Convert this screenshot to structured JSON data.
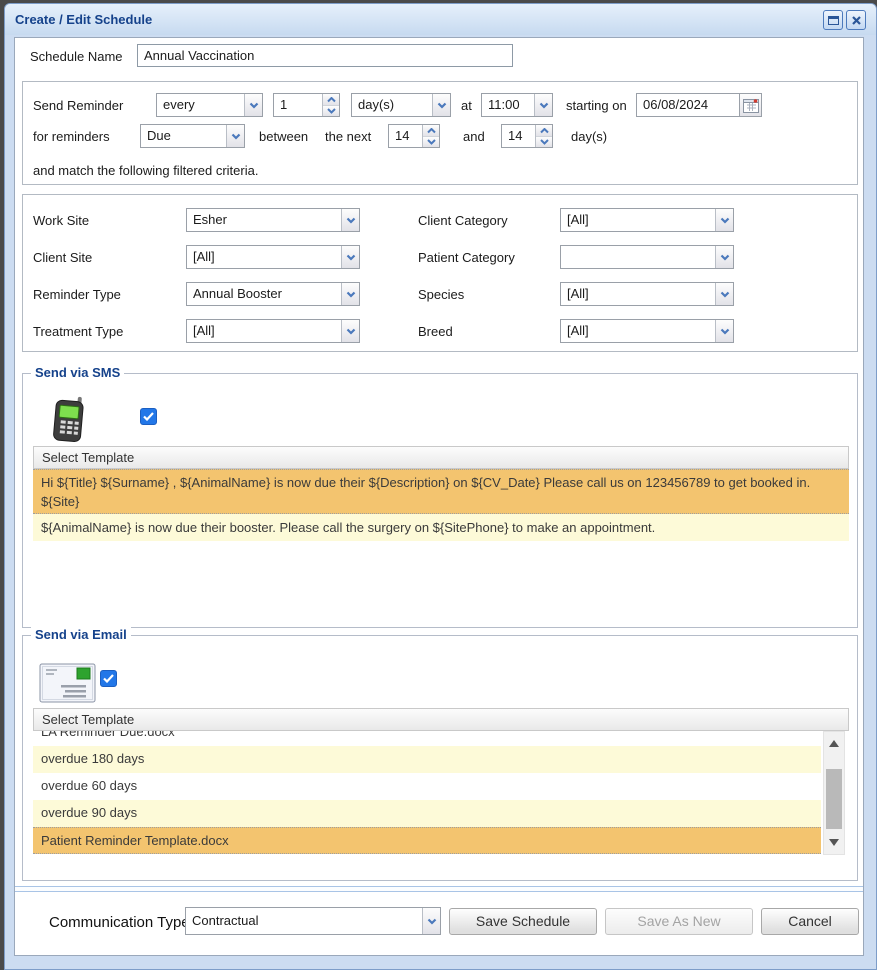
{
  "window": {
    "title": "Create / Edit Schedule"
  },
  "schedule": {
    "name_label": "Schedule Name",
    "name_value": "Annual Vaccination"
  },
  "reminder": {
    "send_label": "Send Reminder",
    "frequency": "every",
    "interval": "1",
    "unit": "day(s)",
    "at_label": "at",
    "time": "11:00",
    "starting_label": "starting on",
    "start_date": "06/08/2024",
    "for_label": "for reminders",
    "status": "Due",
    "between_label": "between",
    "next_label": "the next",
    "window_from": "14",
    "and_label": "and",
    "window_to": "14",
    "days_label": "day(s)",
    "criteria_note": "and match the following filtered criteria."
  },
  "filters": {
    "left": [
      {
        "label": "Work Site",
        "value": "Esher"
      },
      {
        "label": "Client Site",
        "value": "[All]"
      },
      {
        "label": "Reminder Type",
        "value": "Annual Booster"
      },
      {
        "label": "Treatment Type",
        "value": "[All]"
      }
    ],
    "right": [
      {
        "label": "Client Category",
        "value": "[All]"
      },
      {
        "label": "Patient Category",
        "value": ""
      },
      {
        "label": "Species",
        "value": "[All]"
      },
      {
        "label": "Breed",
        "value": "[All]"
      }
    ]
  },
  "sms": {
    "legend": "Send via SMS",
    "checked": true,
    "header": "Select Template",
    "templates": [
      {
        "text": "Hi ${Title} ${Surname} , ${AnimalName} is now due their ${Description} on ${CV_Date} Please call us on 123456789 to get booked in. ${Site}",
        "selected": true
      },
      {
        "text": "${AnimalName} is now due their booster. Please call the surgery on ${SitePhone} to make an appointment.",
        "selected": false
      }
    ]
  },
  "email": {
    "legend": "Send via Email",
    "checked": true,
    "header": "Select Template",
    "templates": [
      {
        "text": "LA Reminder Due.docx",
        "selected": false,
        "clipped": true
      },
      {
        "text": "overdue 180 days",
        "selected": false
      },
      {
        "text": "overdue 60 days",
        "selected": false
      },
      {
        "text": "overdue 90 days",
        "selected": false
      },
      {
        "text": "Patient Reminder Template.docx",
        "selected": true
      }
    ]
  },
  "footer": {
    "communication_label": "Communication Type",
    "communication_value": "Contractual",
    "save_label": "Save Schedule",
    "save_as_new_label": "Save As New",
    "cancel_label": "Cancel"
  },
  "colors": {
    "selection_orange": "#f3c46f",
    "alt_row_yellow": "#fdfad8",
    "title_text": "#15428b",
    "chrome_blue": "#ccdcf1",
    "accent_blue": "#4b79bc",
    "checkbox_blue": "#2277e8"
  }
}
